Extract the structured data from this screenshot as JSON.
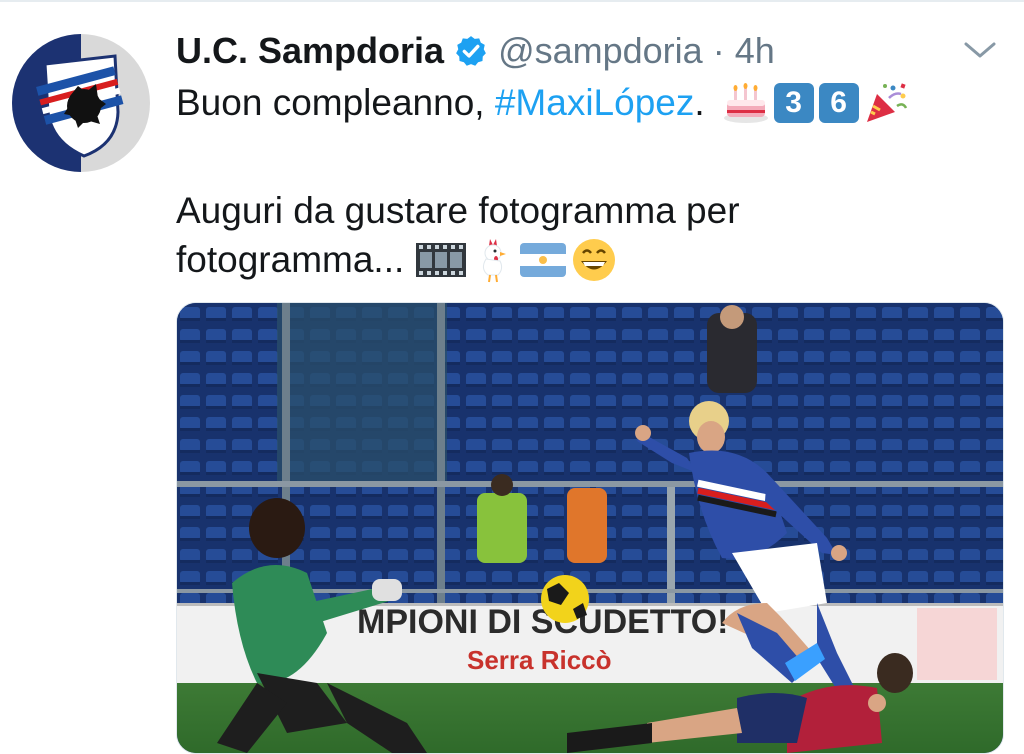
{
  "tweet": {
    "display_name": "U.C. Sampdoria",
    "handle": "@sampdoria",
    "separator": "·",
    "time": "4h",
    "text_prefix": "Buon compleanno, ",
    "hashtag": "#MaxiLópez",
    "text_suffix": ".",
    "keycap_3": "3",
    "keycap_6": "6",
    "line2": "Auguri da gustare fotogramma per",
    "line3": "fotogramma...",
    "media": {
      "banner_text": "MPIONI DI SCUDETTO!",
      "banner_sponsor": "Serra Riccò"
    }
  },
  "icons": [
    "avatar",
    "verified-badge-icon",
    "chevron-down-icon",
    "birthday-cake-emoji",
    "film-frames-emoji",
    "rooster-emoji",
    "argentina-flag-emoji",
    "grinning-face-emoji",
    "party-popper-emoji"
  ],
  "colors": {
    "link": "#1da1f2",
    "muted": "#657786",
    "verified": "#1da1f2"
  }
}
